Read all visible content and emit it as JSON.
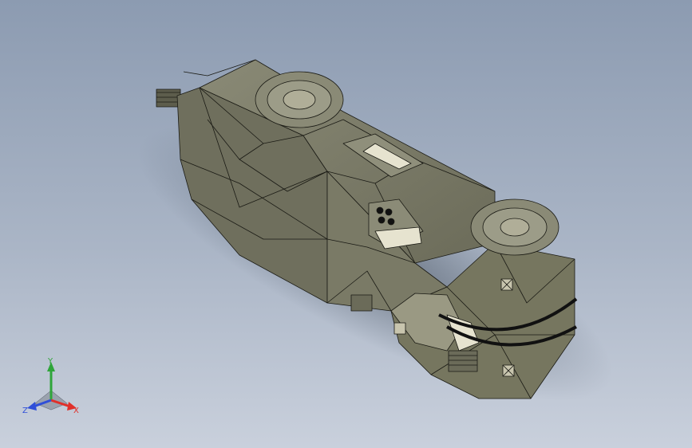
{
  "viewport": {
    "background_top": "#8c9bb1",
    "background_bottom": "#c9d0dc",
    "model_fill": "#7d7d69",
    "model_edge": "#1a1a14",
    "highlight_fill": "#e6e3cf"
  },
  "triad": {
    "x_label": "X",
    "y_label": "Y",
    "z_label": "Z",
    "x_color": "#e0302a",
    "y_color": "#2fa53a",
    "z_color": "#2f4fd8"
  }
}
